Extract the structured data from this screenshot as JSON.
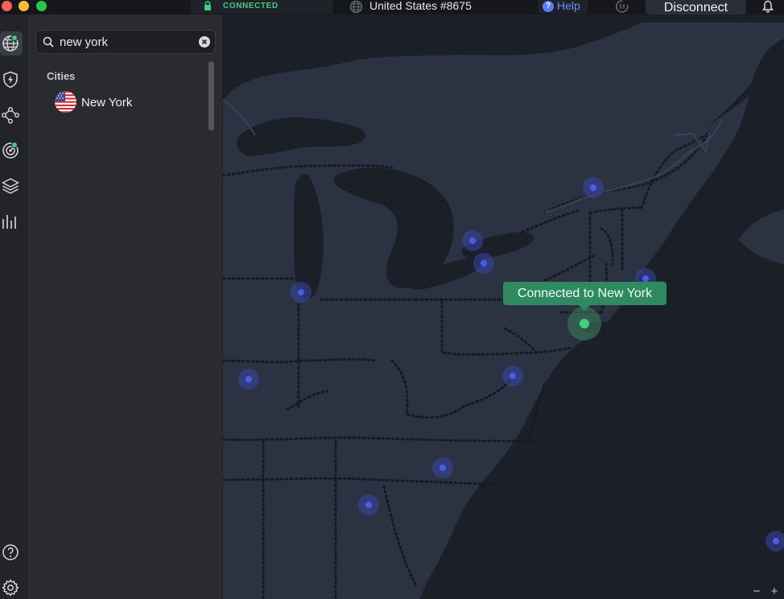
{
  "titlebar": {
    "connection_status": "CONNECTED",
    "server_name": "United States #8675",
    "help_label": "Help",
    "disconnect_label": "Disconnect"
  },
  "rail": {
    "items": [
      {
        "name": "countries-globe-icon",
        "active": true,
        "badge": true
      },
      {
        "name": "threat-protection-icon",
        "active": false,
        "badge": false
      },
      {
        "name": "meshnet-icon",
        "active": false,
        "badge": false
      },
      {
        "name": "dark-web-monitor-icon",
        "active": false,
        "badge": true
      },
      {
        "name": "specialty-servers-layers-icon",
        "active": false,
        "badge": false
      },
      {
        "name": "statistics-bars-icon",
        "active": false,
        "badge": false
      }
    ],
    "bottom_items": [
      {
        "name": "help-question-icon"
      },
      {
        "name": "settings-gear-icon"
      }
    ]
  },
  "panel": {
    "search": {
      "value": "new york",
      "placeholder": "Search"
    },
    "section_label": "Cities",
    "results": [
      {
        "name": "New York",
        "flag": "us-flag-icon"
      }
    ]
  },
  "map": {
    "tooltip": "Connected to New York",
    "colors": {
      "land": "#2b3343",
      "water": "#1b1f27",
      "server_dot": "#4a5cf0",
      "connected_dot": "#3fd07f",
      "tooltip_bg": "#2f8a61"
    },
    "zoom_out": "−",
    "zoom_in": "+"
  }
}
